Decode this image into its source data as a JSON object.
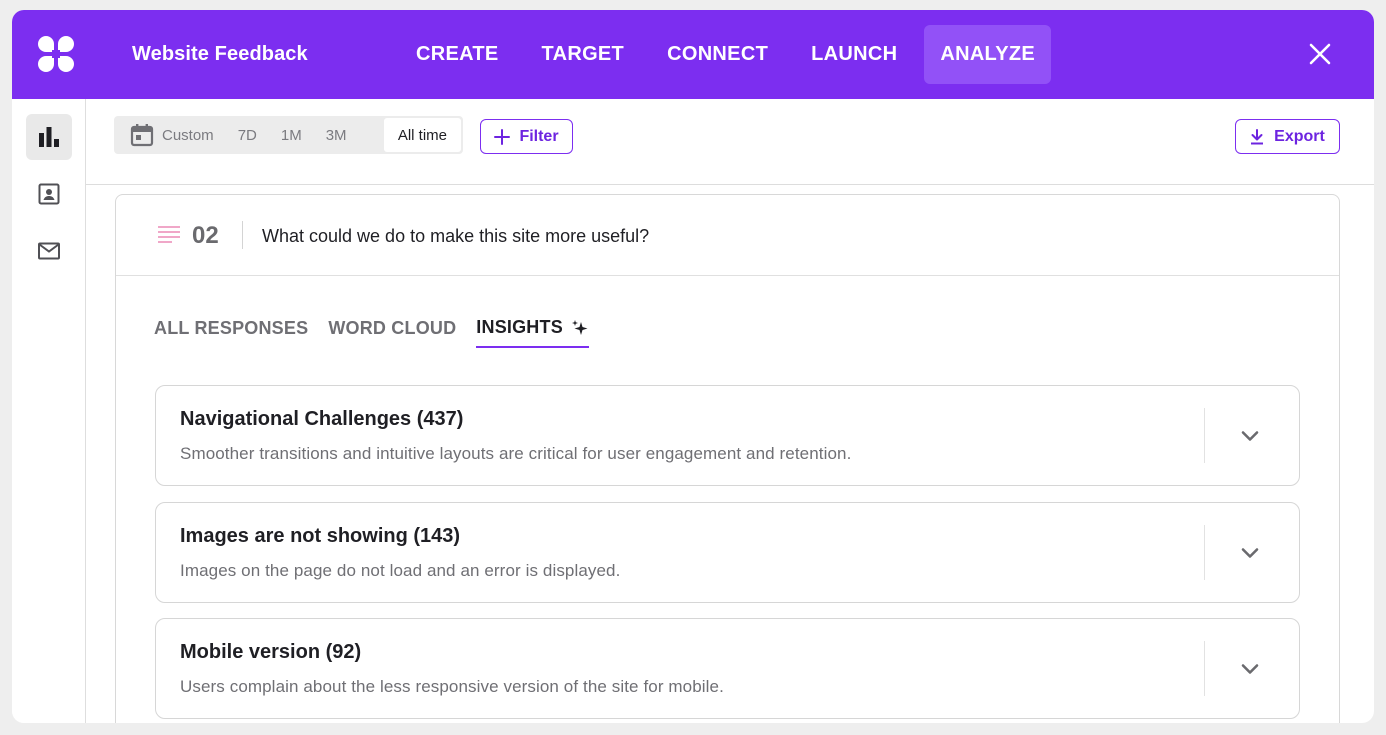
{
  "app": {
    "title": "Website Feedback"
  },
  "nav": {
    "items": [
      {
        "label": "CREATE"
      },
      {
        "label": "TARGET"
      },
      {
        "label": "CONNECT"
      },
      {
        "label": "LAUNCH"
      },
      {
        "label": "ANALYZE",
        "active": true
      }
    ]
  },
  "rail": {
    "items": [
      {
        "icon": "bar-chart-icon",
        "active": true
      },
      {
        "icon": "contact-card-icon"
      },
      {
        "icon": "mail-icon"
      }
    ]
  },
  "toolbar": {
    "range": {
      "options": [
        "Custom",
        "7D",
        "1M",
        "3M",
        "All time"
      ],
      "selected": "All time"
    },
    "filter_label": "Filter",
    "export_label": "Export"
  },
  "question": {
    "number": "02",
    "text": "What could we do to make this site more useful?"
  },
  "tabs": [
    {
      "label": "ALL RESPONSES"
    },
    {
      "label": "WORD CLOUD"
    },
    {
      "label": "INSIGHTS",
      "active": true
    }
  ],
  "insights": [
    {
      "title": "Navigational Challenges (437)",
      "description": "Smoother transitions and intuitive layouts are critical for user engagement and retention."
    },
    {
      "title": "Images are not showing (143)",
      "description": "Images on the page do not load and an error is displayed."
    },
    {
      "title": "Mobile version (92)",
      "description": "Users complain about the less responsive version of the site for mobile."
    }
  ],
  "colors": {
    "brand": "#7c2ef0",
    "nav_active": "#9251f7",
    "question_icon": "#f0a7c8"
  }
}
